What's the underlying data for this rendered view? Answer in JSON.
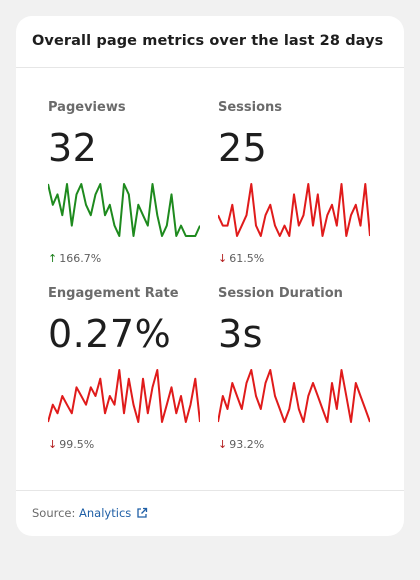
{
  "card": {
    "title": "Overall page metrics over the last 28 days"
  },
  "metrics": [
    {
      "label": "Pageviews",
      "value": "32",
      "change": "166.7%",
      "direction": "up",
      "color": "#1e8a1e",
      "spark": [
        6,
        4,
        5,
        3,
        6,
        2,
        5,
        6,
        4,
        3,
        5,
        6,
        3,
        4,
        2,
        1,
        6,
        5,
        1,
        4,
        3,
        2,
        6,
        3,
        1,
        2,
        5,
        1,
        2,
        1,
        1,
        1,
        2
      ]
    },
    {
      "label": "Sessions",
      "value": "25",
      "change": "61.5%",
      "direction": "down",
      "color": "#e01b1b",
      "spark": [
        3,
        2,
        2,
        4,
        1,
        2,
        3,
        6,
        2,
        1,
        3,
        4,
        2,
        1,
        2,
        1,
        5,
        2,
        3,
        6,
        2,
        5,
        1,
        3,
        4,
        2,
        6,
        1,
        3,
        4,
        2,
        6,
        1
      ]
    },
    {
      "label": "Engagement Rate",
      "value": "0.27%",
      "change": "99.5%",
      "direction": "down",
      "color": "#e01b1b",
      "spark": [
        1,
        3,
        2,
        4,
        3,
        2,
        5,
        4,
        3,
        5,
        4,
        6,
        2,
        4,
        3,
        7,
        2,
        6,
        3,
        1,
        6,
        2,
        5,
        7,
        1,
        3,
        5,
        2,
        4,
        1,
        3,
        6,
        1
      ]
    },
    {
      "label": "Session Duration",
      "value": "3s",
      "change": "93.2%",
      "direction": "down",
      "color": "#e01b1b",
      "spark": [
        1,
        3,
        2,
        4,
        3,
        2,
        4,
        5,
        3,
        2,
        4,
        5,
        3,
        2,
        1,
        2,
        4,
        2,
        1,
        3,
        4,
        3,
        2,
        1,
        4,
        2,
        5,
        3,
        1,
        4,
        3,
        2,
        1
      ]
    }
  ],
  "footer": {
    "source_label": "Source:",
    "source_link": "Analytics",
    "link_icon": "external-link-icon"
  }
}
